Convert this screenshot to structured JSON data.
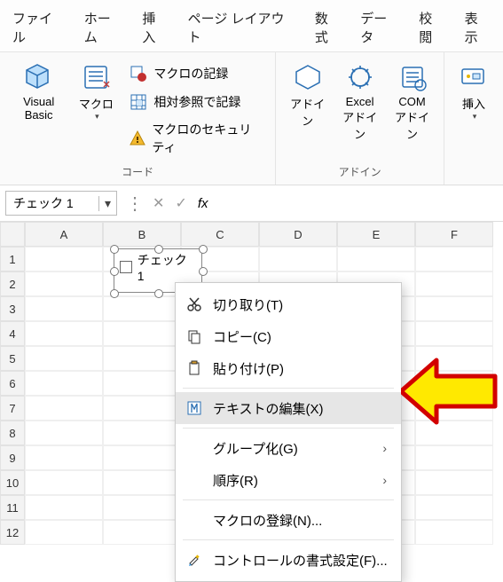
{
  "menu": {
    "items": [
      "ファイル",
      "ホーム",
      "挿入",
      "ページ レイアウト",
      "数式",
      "データ",
      "校閲",
      "表示"
    ]
  },
  "ribbon": {
    "code": {
      "vb": "Visual Basic",
      "macros": "マクロ",
      "record": "マクロの記録",
      "relative": "相対参照で記録",
      "security": "マクロのセキュリティ",
      "group_label": "コード"
    },
    "addins": {
      "addins": "アドイン",
      "excel": "Excel\nアドイン",
      "com": "COM\nアドイン",
      "group_label": "アドイン"
    },
    "insert": {
      "label": "挿入"
    }
  },
  "namebox": {
    "value": "チェック 1"
  },
  "fx": {
    "label": "fx"
  },
  "columns": [
    "A",
    "B",
    "C",
    "D",
    "E",
    "F"
  ],
  "rows": [
    "1",
    "2",
    "3",
    "4",
    "5",
    "6",
    "7",
    "8",
    "9",
    "10",
    "11",
    "12"
  ],
  "shape": {
    "label": "チェック 1"
  },
  "ctx": {
    "cut": "切り取り(T)",
    "copy": "コピー(C)",
    "paste": "貼り付け(P)",
    "edit_text": "テキストの編集(X)",
    "group": "グループ化(G)",
    "order": "順序(R)",
    "assign": "マクロの登録(N)...",
    "format": "コントロールの書式設定(F)..."
  }
}
